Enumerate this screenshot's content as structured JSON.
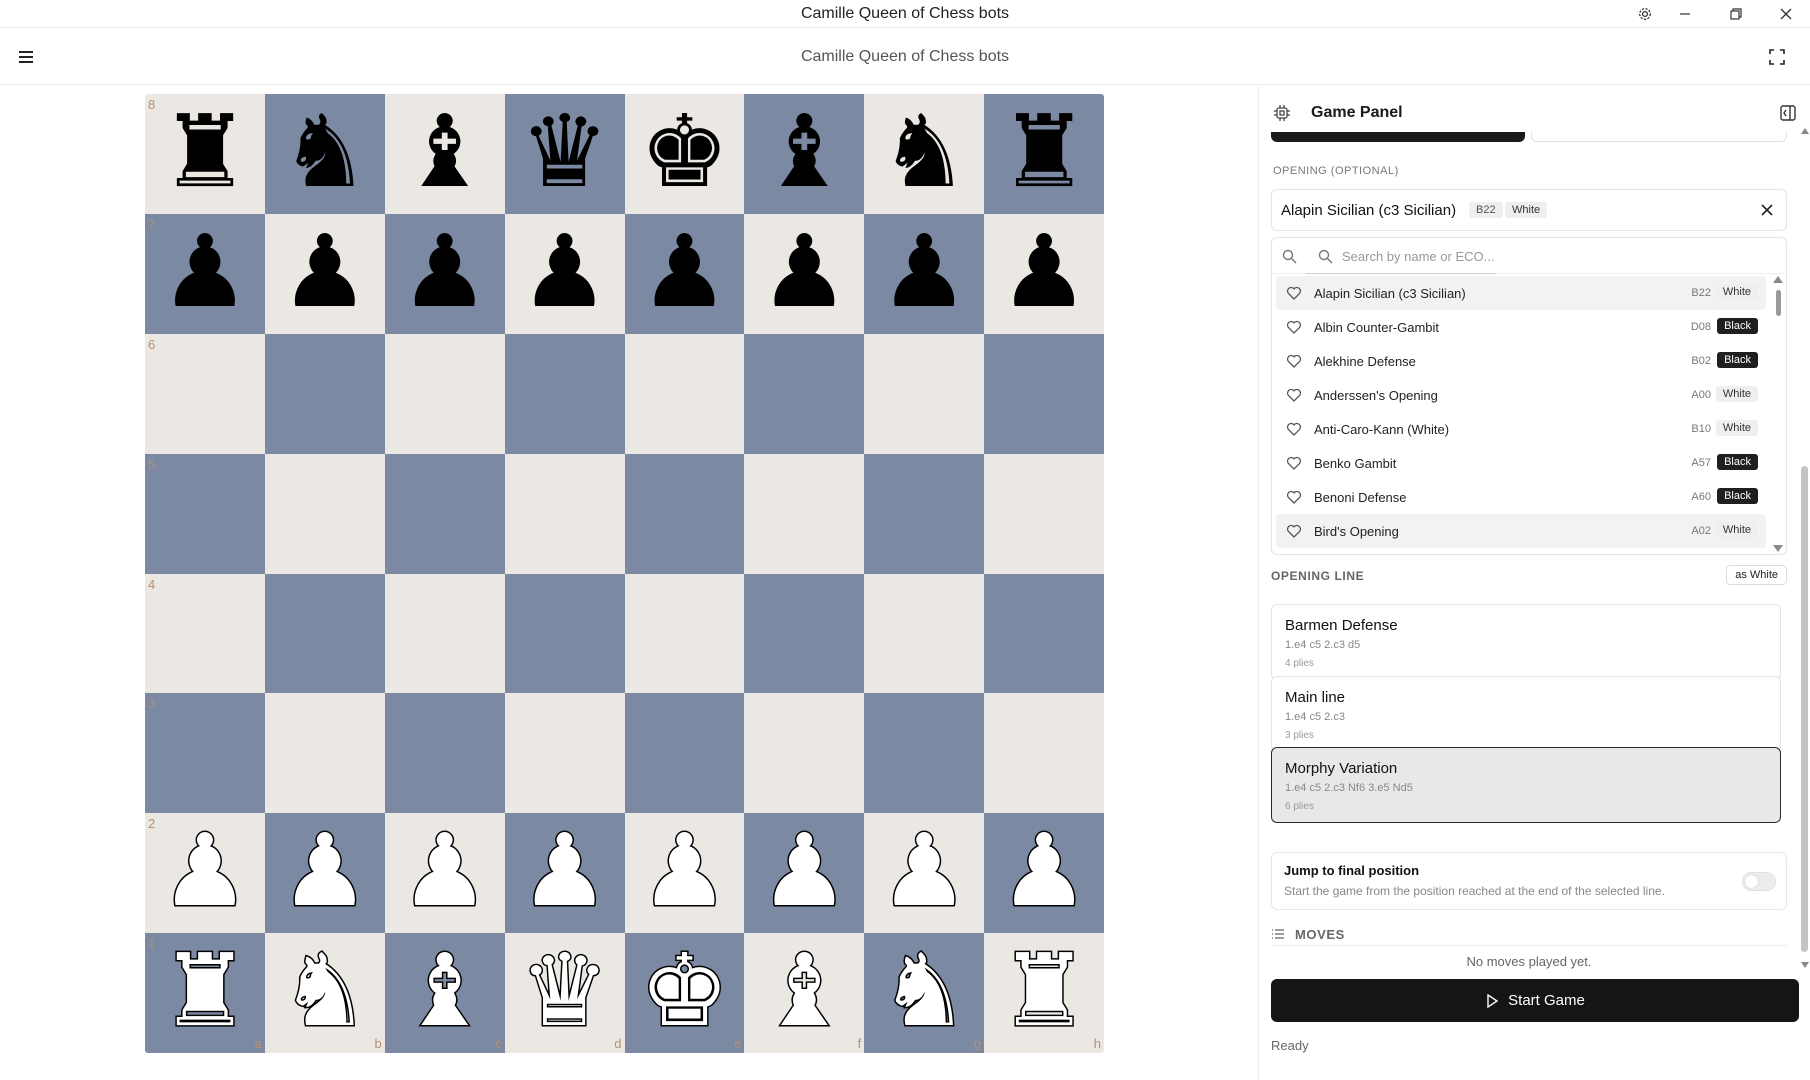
{
  "window": {
    "title": "Camille Queen of Chess bots",
    "buttons": {
      "settings": "gear-icon",
      "minimize": "minimize-icon",
      "restore": "restore-icon",
      "close": "close-icon"
    }
  },
  "header": {
    "subtitle": "Camille Queen of Chess bots",
    "menu_icon": "hamburger-icon",
    "fullscreen_icon": "fullscreen-icon"
  },
  "board": {
    "colors": {
      "light": "#ebe8e3",
      "dark": "#7b89a3",
      "coord": "#b69073"
    },
    "ranks": [
      "8",
      "7",
      "6",
      "5",
      "4",
      "3",
      "2",
      "1"
    ],
    "files": [
      "a",
      "b",
      "c",
      "d",
      "e",
      "f",
      "g",
      "h"
    ],
    "position": [
      [
        "br",
        "bn",
        "bb",
        "bq",
        "bk",
        "bb",
        "bn",
        "br"
      ],
      [
        "bp",
        "bp",
        "bp",
        "bp",
        "bp",
        "bp",
        "bp",
        "bp"
      ],
      [
        "",
        "",
        "",
        "",
        "",
        "",
        "",
        ""
      ],
      [
        "",
        "",
        "",
        "",
        "",
        "",
        "",
        ""
      ],
      [
        "",
        "",
        "",
        "",
        "",
        "",
        "",
        ""
      ],
      [
        "",
        "",
        "",
        "",
        "",
        "",
        "",
        ""
      ],
      [
        "wp",
        "wp",
        "wp",
        "wp",
        "wp",
        "wp",
        "wp",
        "wp"
      ],
      [
        "wr",
        "wn",
        "wb",
        "wq",
        "wk",
        "wb",
        "wn",
        "wr"
      ]
    ],
    "glyphs": {
      "k": "♚",
      "q": "♛",
      "r": "♜",
      "b": "♝",
      "n": "♞",
      "p": "♟"
    }
  },
  "panel": {
    "title": "Game Panel",
    "opening_label": "OPENING (OPTIONAL)",
    "selected": {
      "name": "Alapin Sicilian (c3 Sicilian)",
      "eco": "B22",
      "side": "White"
    },
    "search_placeholder": "Search by name or ECO...",
    "openings": [
      {
        "name": "Alapin Sicilian (c3 Sicilian)",
        "eco": "B22",
        "side": "White"
      },
      {
        "name": "Albin Counter-Gambit",
        "eco": "D08",
        "side": "Black"
      },
      {
        "name": "Alekhine Defense",
        "eco": "B02",
        "side": "Black"
      },
      {
        "name": "Anderssen's Opening",
        "eco": "A00",
        "side": "White"
      },
      {
        "name": "Anti-Caro-Kann (White)",
        "eco": "B10",
        "side": "White"
      },
      {
        "name": "Benko Gambit",
        "eco": "A57",
        "side": "Black"
      },
      {
        "name": "Benoni Defense",
        "eco": "A60",
        "side": "Black"
      },
      {
        "name": "Bird's Opening",
        "eco": "A02",
        "side": "White"
      }
    ],
    "line_label": "OPENING LINE",
    "as_side": "as White",
    "lines": [
      {
        "name": "Barmen Defense",
        "moves": "1.e4 c5 2.c3 d5",
        "plies": "4 plies"
      },
      {
        "name": "Main line",
        "moves": "1.e4 c5 2.c3",
        "plies": "3 plies"
      },
      {
        "name": "Morphy Variation",
        "moves": "1.e4 c5 2.c3 Nf6 3.e5 Nd5",
        "plies": "6 plies"
      }
    ],
    "selected_line_index": 2,
    "jump": {
      "title": "Jump to final position",
      "desc": "Start the game from the position reached at the end of the selected line.",
      "enabled": false
    },
    "moves_label": "MOVES",
    "no_moves": "No moves played yet.",
    "start_button": "Start Game",
    "status": "Ready"
  }
}
